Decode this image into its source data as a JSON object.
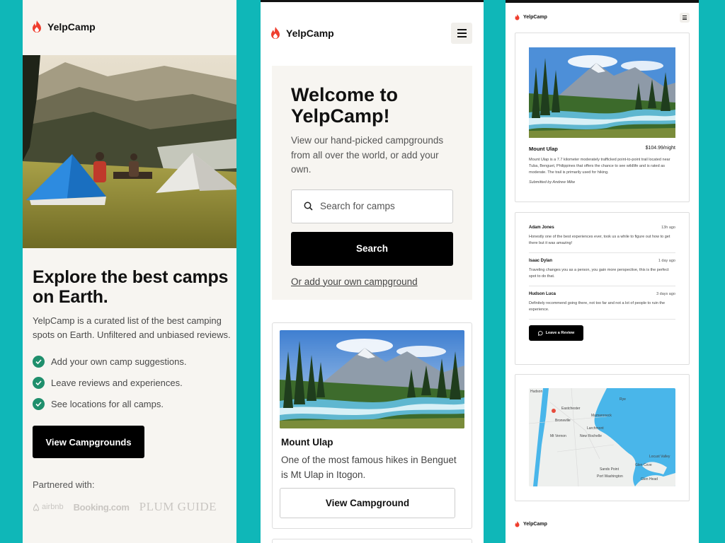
{
  "brand": {
    "name": "YelpCamp"
  },
  "colors": {
    "background": "#0fb7b8",
    "accent_red": "#ef3e2e",
    "check_green": "#1f8f6c",
    "map_water": "#49b6ea"
  },
  "landing": {
    "heading": "Explore the best camps on Earth.",
    "description": "YelpCamp is a curated list of the best camping spots on Earth. Unfiltered and unbiased reviews.",
    "features": [
      {
        "icon": "check-icon",
        "text": "Add your own camp suggestions."
      },
      {
        "icon": "check-icon",
        "text": "Leave reviews and experiences."
      },
      {
        "icon": "check-icon",
        "text": "See locations for all camps."
      }
    ],
    "cta_label": "View Campgrounds",
    "partners_label": "Partnered with:",
    "partners": [
      "airbnb",
      "Booking.com",
      "PLUM GUIDE"
    ]
  },
  "campgrounds": {
    "menu_icon": "hamburger-icon",
    "welcome_title": "Welcome to YelpCamp!",
    "welcome_desc": "View our hand-picked campgrounds from all over the world, or add your own.",
    "search_placeholder": "Search for camps",
    "search_label": "Search",
    "add_link": "Or add your own campground",
    "card": {
      "name": "Mount Ulap",
      "description": "One of the most famous hikes in Benguet is Mt Ulap in Itogon.",
      "button_label": "View Campground"
    }
  },
  "detail": {
    "name": "Mount Ulap",
    "price": "$104.99/night",
    "description": "Mount Ulap is a 7.7 kilometer moderately trafficked point-to-point trail located near Tuba, Benguet, Philippines that offers the chance to see wildlife and is rated as moderate. The trail is primarily used for hiking.",
    "submitted_by": "Submitted by Andrew Mike",
    "reviews": [
      {
        "author": "Adam Jones",
        "time": "13h ago",
        "text": "Honestly one of the best experiences ever, took us a while to figure out how to get there but it was amazing!"
      },
      {
        "author": "Isaac Dylan",
        "time": "1 day ago",
        "text": "Traveling changes you as a person, you gain more perspective, this is the perfect spot to do that."
      },
      {
        "author": "Hudson Luca",
        "time": "3 days ago",
        "text": "Definitely recommend going there, not too far and not a lot of people to ruin the experience."
      }
    ],
    "leave_review_label": "Leave a Review",
    "map_labels": [
      "Hudson",
      "Eastchester",
      "Rye",
      "Mamaroneck",
      "Bronxville",
      "Larchmont",
      "Mt Vernon",
      "New Rochelle",
      "Locust Valley",
      "Sands Point",
      "Glen Cove",
      "Glen Head",
      "Port Washington"
    ]
  }
}
